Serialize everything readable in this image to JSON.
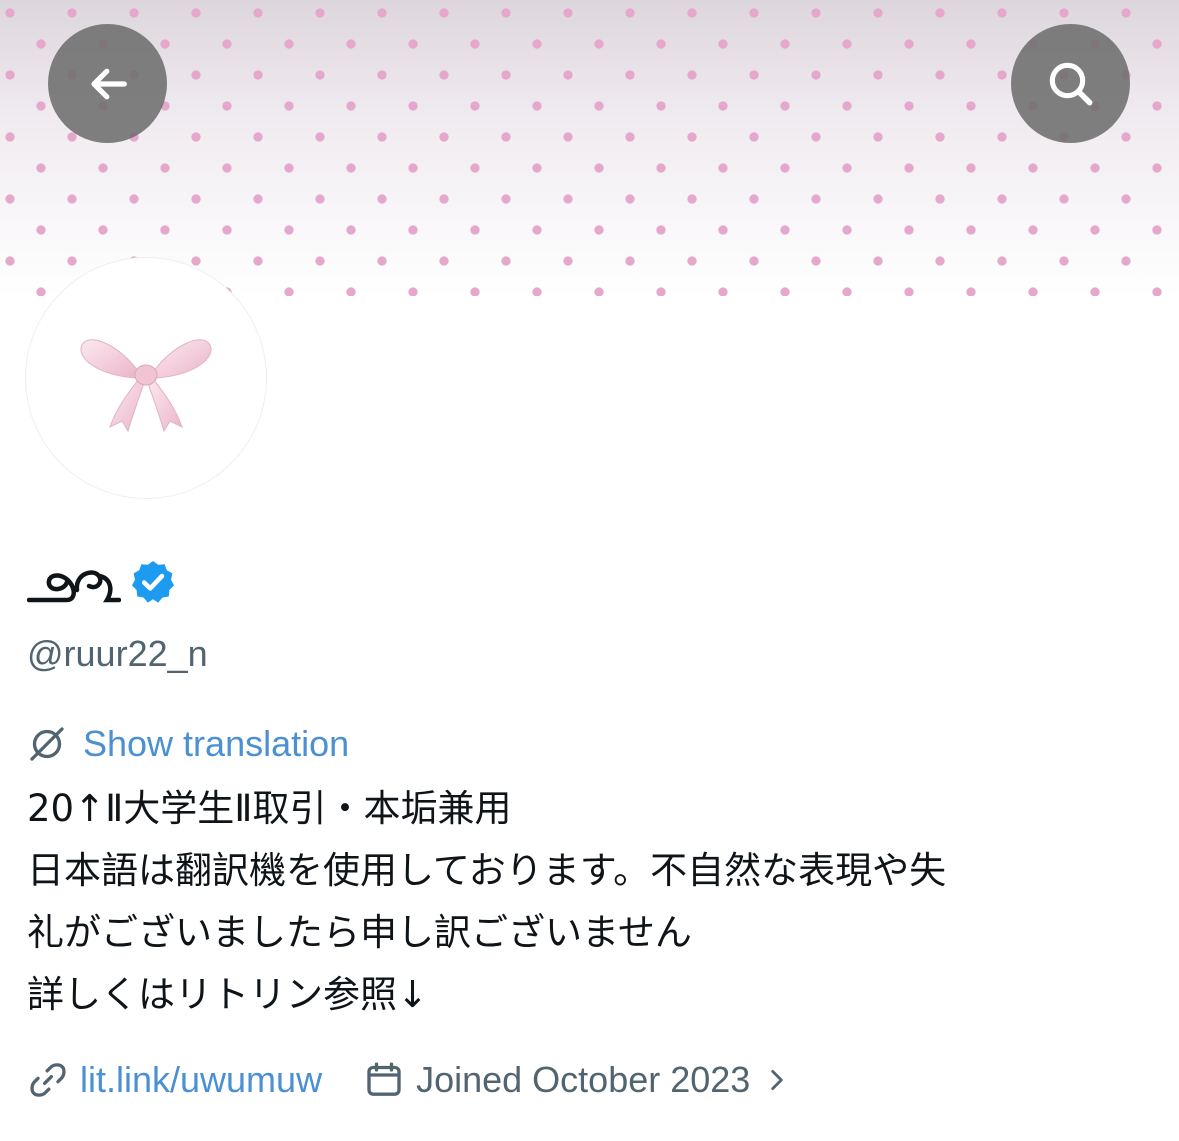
{
  "profile": {
    "display_name": "୨୧",
    "handle": "@ruur22_n",
    "verified": true,
    "show_translation": "Show translation",
    "bio_lines": [
      "20↑Ⅱ大学生Ⅱ取引・本垢兼用",
      "日本語は翻訳機を使用しております。不自然な表現や失",
      "礼がございましたら申し訳ございません",
      "詳しくはリトリン参照↓"
    ],
    "link": "lit.link/uwumuw",
    "joined": "Joined October 2023"
  },
  "icons": {
    "back": "back-arrow-icon",
    "search": "search-icon",
    "verified": "verified-badge-icon",
    "translate": "translate-icon",
    "link": "link-icon",
    "calendar": "calendar-icon",
    "chevron": "chevron-right-icon"
  },
  "colors": {
    "accent": "#4a90d2",
    "verified": "#1d9bf0",
    "secondary_text": "#536471",
    "banner_dot": "#e5a7cc"
  }
}
